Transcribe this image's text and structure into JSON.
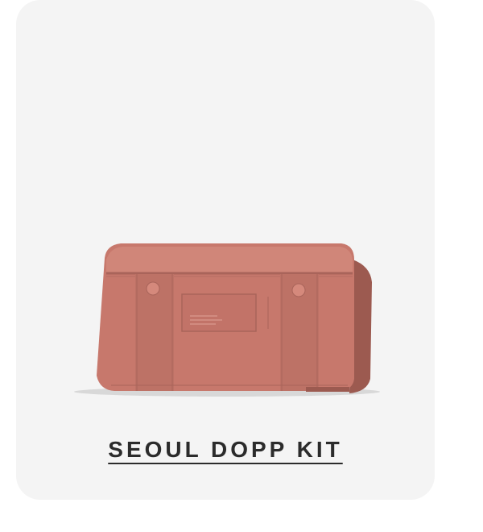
{
  "product": {
    "title": "SEOUL DOPP KIT",
    "image_icon": "dopp-kit-bag-image",
    "bag_color": "#c7786c",
    "card_background": "#f4f4f4",
    "title_color": "#2b2b2b"
  }
}
